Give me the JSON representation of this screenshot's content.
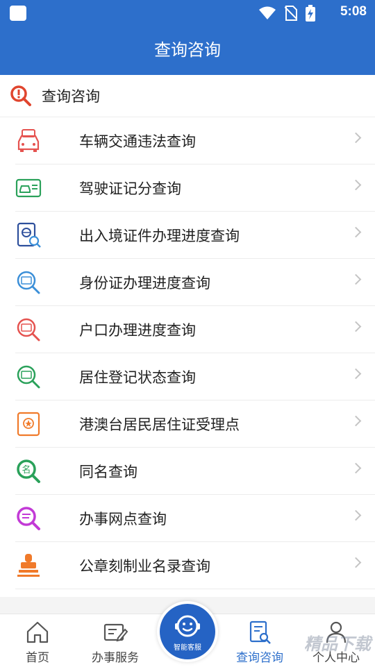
{
  "status_bar": {
    "time": "5:08",
    "icons": [
      "notification-icon",
      "wifi-icon",
      "no-sim-icon",
      "battery-charging-icon"
    ]
  },
  "app_bar": {
    "title": "查询咨询"
  },
  "section": {
    "title": "查询咨询",
    "icon": "search-alert-icon"
  },
  "list": [
    {
      "label": "车辆交通违法查询",
      "icon": "car-violation-icon",
      "color": "#e5524f"
    },
    {
      "label": "驾驶证记分查询",
      "icon": "driver-license-icon",
      "color": "#2aa15a"
    },
    {
      "label": "出入境证件办理进度查询",
      "icon": "passport-icon",
      "color": "#2d4f9c"
    },
    {
      "label": "身份证办理进度查询",
      "icon": "id-card-search-icon",
      "color": "#3b8fd8"
    },
    {
      "label": "户口办理进度查询",
      "icon": "household-search-icon",
      "color": "#e5524f"
    },
    {
      "label": "居住登记状态查询",
      "icon": "residence-search-icon",
      "color": "#2aa15a"
    },
    {
      "label": "港澳台居民居住证受理点",
      "icon": "residence-permit-icon",
      "color": "#f07a2a"
    },
    {
      "label": "同名查询",
      "icon": "same-name-search-icon",
      "color": "#2aa15a"
    },
    {
      "label": "办事网点查询",
      "icon": "service-outlet-search-icon",
      "color": "#c23ad6"
    },
    {
      "label": "公章刻制业名录查询",
      "icon": "seal-stamp-icon",
      "color": "#f07a2a"
    }
  ],
  "tabs": [
    {
      "label": "首页",
      "icon": "home-icon"
    },
    {
      "label": "办事服务",
      "icon": "service-edit-icon"
    },
    {
      "label": "查询咨询",
      "icon": "query-document-icon",
      "active": true
    },
    {
      "label": "个人中心",
      "icon": "person-icon"
    }
  ],
  "center_button": {
    "label": "智能客服",
    "icon": "customer-service-icon"
  },
  "colors": {
    "primary": "#2d6fcb",
    "divider": "#ececec",
    "text": "#222222"
  },
  "watermark": "精品下载"
}
